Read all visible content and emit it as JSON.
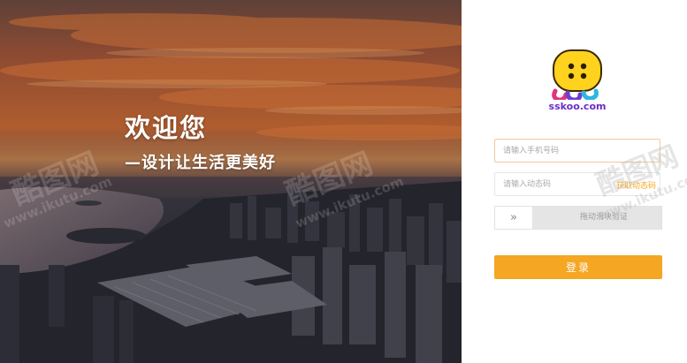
{
  "hero": {
    "title": "欢迎您",
    "subtitle": "—设计让生活更美好"
  },
  "watermark": {
    "brand": "酷图网",
    "url": "www.ikutu.com"
  },
  "login": {
    "logo_text": "sskoo.com",
    "phone_placeholder": "请输入手机号码",
    "code_placeholder": "请输入动态码",
    "send_code_label": "获取动态码",
    "slider_icon": "double-chevron-right-icon",
    "slider_text": "拖动滑块验证",
    "submit_label": "登录"
  },
  "colors": {
    "accent": "#f5a623",
    "panel_bg": "#ffffff",
    "input_border": "#e6e6e6"
  }
}
